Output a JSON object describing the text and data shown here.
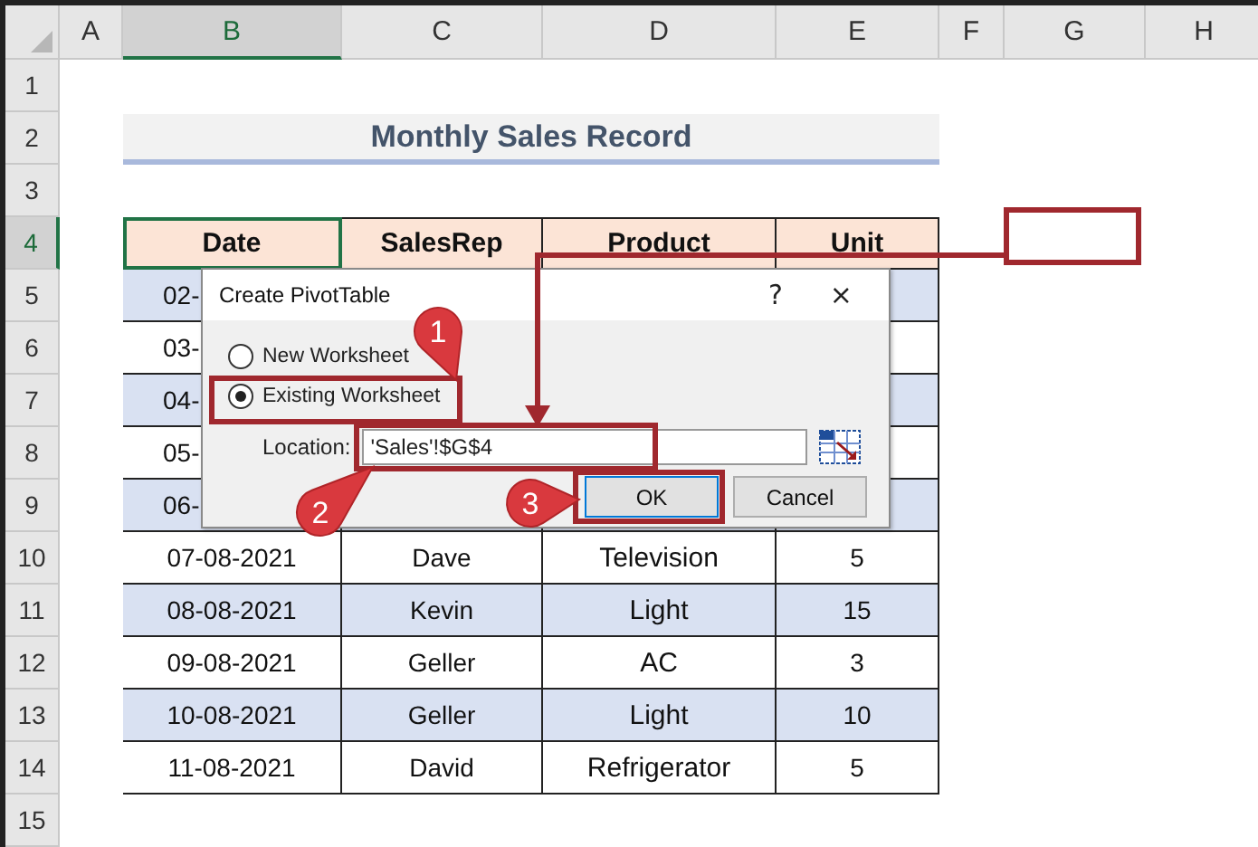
{
  "sheet": {
    "columns": [
      {
        "label": "A",
        "selected": false
      },
      {
        "label": "B",
        "selected": true
      },
      {
        "label": "C",
        "selected": false
      },
      {
        "label": "D",
        "selected": false
      },
      {
        "label": "E",
        "selected": false
      },
      {
        "label": "F",
        "selected": false
      },
      {
        "label": "G",
        "selected": false
      },
      {
        "label": "H",
        "selected": false
      }
    ],
    "rows": [
      {
        "label": "1",
        "selected": false
      },
      {
        "label": "2",
        "selected": false
      },
      {
        "label": "3",
        "selected": false
      },
      {
        "label": "4",
        "selected": true
      },
      {
        "label": "5",
        "selected": false
      },
      {
        "label": "6",
        "selected": false
      },
      {
        "label": "7",
        "selected": false
      },
      {
        "label": "8",
        "selected": false
      },
      {
        "label": "9",
        "selected": false
      },
      {
        "label": "10",
        "selected": false
      },
      {
        "label": "11",
        "selected": false
      },
      {
        "label": "12",
        "selected": false
      },
      {
        "label": "13",
        "selected": false
      },
      {
        "label": "14",
        "selected": false
      },
      {
        "label": "15",
        "selected": false
      }
    ]
  },
  "title": "Monthly Sales Record",
  "table": {
    "columns": [
      "Date",
      "SalesRep",
      "Product",
      "Unit"
    ],
    "rows": [
      {
        "cells": [
          "02-"
        ]
      },
      {
        "cells": [
          "03-"
        ]
      },
      {
        "cells": [
          "04-"
        ]
      },
      {
        "cells": [
          "05-"
        ]
      },
      {
        "cells": [
          "06-"
        ]
      },
      {
        "cells": [
          "07-08-2021",
          "Dave",
          "Television",
          "5"
        ]
      },
      {
        "cells": [
          "08-08-2021",
          "Kevin",
          "Light",
          "15"
        ]
      },
      {
        "cells": [
          "09-08-2021",
          "Geller",
          "AC",
          "3"
        ]
      },
      {
        "cells": [
          "10-08-2021",
          "Geller",
          "Light",
          "10"
        ]
      },
      {
        "cells": [
          "11-08-2021",
          "David",
          "Refrigerator",
          "5"
        ]
      }
    ]
  },
  "dialog": {
    "title": "Create PivotTable",
    "help": "?",
    "close": "×",
    "options": [
      {
        "label": "New Worksheet",
        "selected": false
      },
      {
        "label": "Existing Worksheet",
        "selected": true
      }
    ],
    "location": {
      "label": "Location:",
      "value": "'Sales'!$G$4"
    },
    "buttons": [
      "OK",
      "Cancel"
    ]
  },
  "callouts": [
    "1",
    "2",
    "3"
  ]
}
